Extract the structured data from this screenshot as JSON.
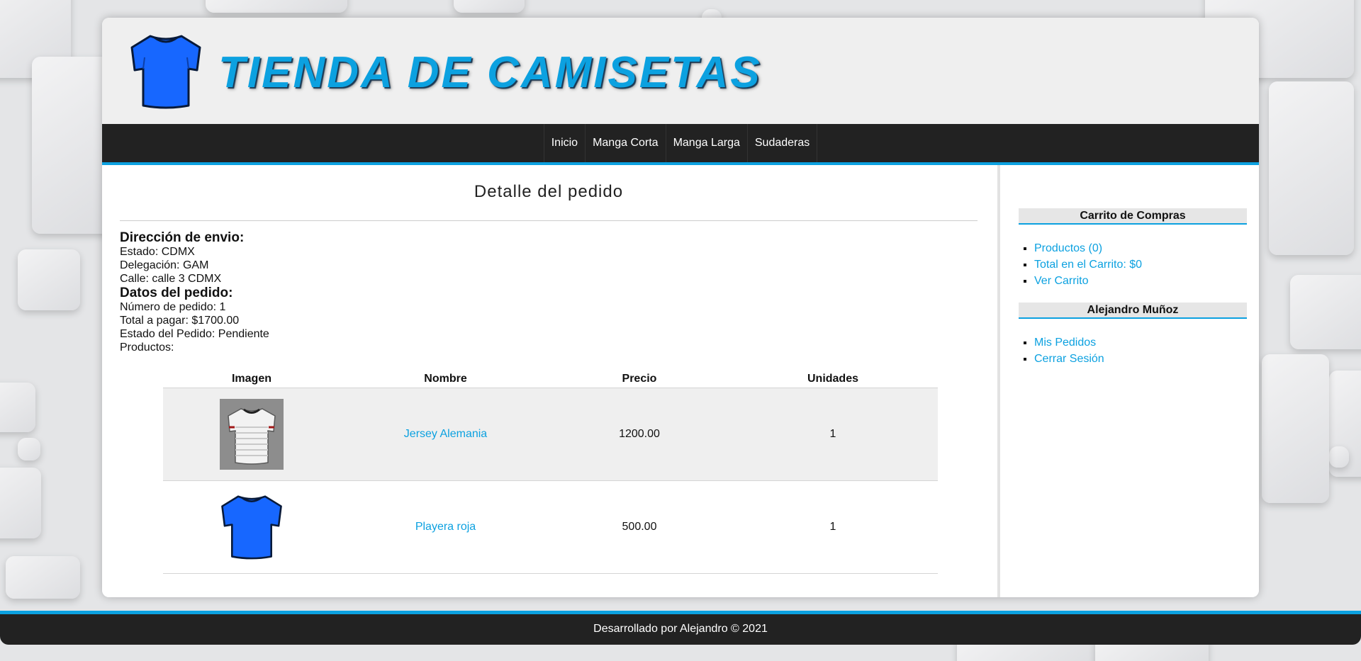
{
  "brand": {
    "title": "TIENDA DE CAMISETAS",
    "logo_icon": "tshirt-icon",
    "accent": "#0ca1e0",
    "tshirt_color": "#1767ff"
  },
  "nav": {
    "items": [
      {
        "label": "Inicio"
      },
      {
        "label": "Manga Corta"
      },
      {
        "label": "Manga Larga"
      },
      {
        "label": "Sudaderas"
      }
    ]
  },
  "main": {
    "title": "Detalle del pedido",
    "shipping": {
      "heading": "Dirección de envio:",
      "estado": "Estado: CDMX",
      "delegacion": "Delegación: GAM",
      "calle": "Calle: calle 3 CDMX"
    },
    "order": {
      "heading": "Datos del pedido:",
      "numero": "Número de pedido: 1",
      "total": "Total a pagar: $1700.00",
      "estado": "Estado del Pedido: Pendiente",
      "productos_label": "Productos:"
    },
    "table": {
      "headers": [
        "Imagen",
        "Nombre",
        "Precio",
        "Unidades"
      ],
      "rows": [
        {
          "image_icon": "jersey-image",
          "name": "Jersey Alemania",
          "price": "1200.00",
          "units": "1"
        },
        {
          "image_icon": "tshirt-icon",
          "name": "Playera roja",
          "price": "500.00",
          "units": "1"
        }
      ]
    }
  },
  "sidebar": {
    "cart": {
      "heading": "Carrito de Compras",
      "items": [
        {
          "label": "Productos (0)"
        },
        {
          "label": "Total en el Carrito: $0"
        },
        {
          "label": "Ver Carrito"
        }
      ]
    },
    "user": {
      "heading": "Alejandro Muñoz",
      "items": [
        {
          "label": "Mis Pedidos"
        },
        {
          "label": "Cerrar Sesión"
        }
      ]
    }
  },
  "footer": {
    "text": "Desarrollado por Alejandro © 2021"
  }
}
